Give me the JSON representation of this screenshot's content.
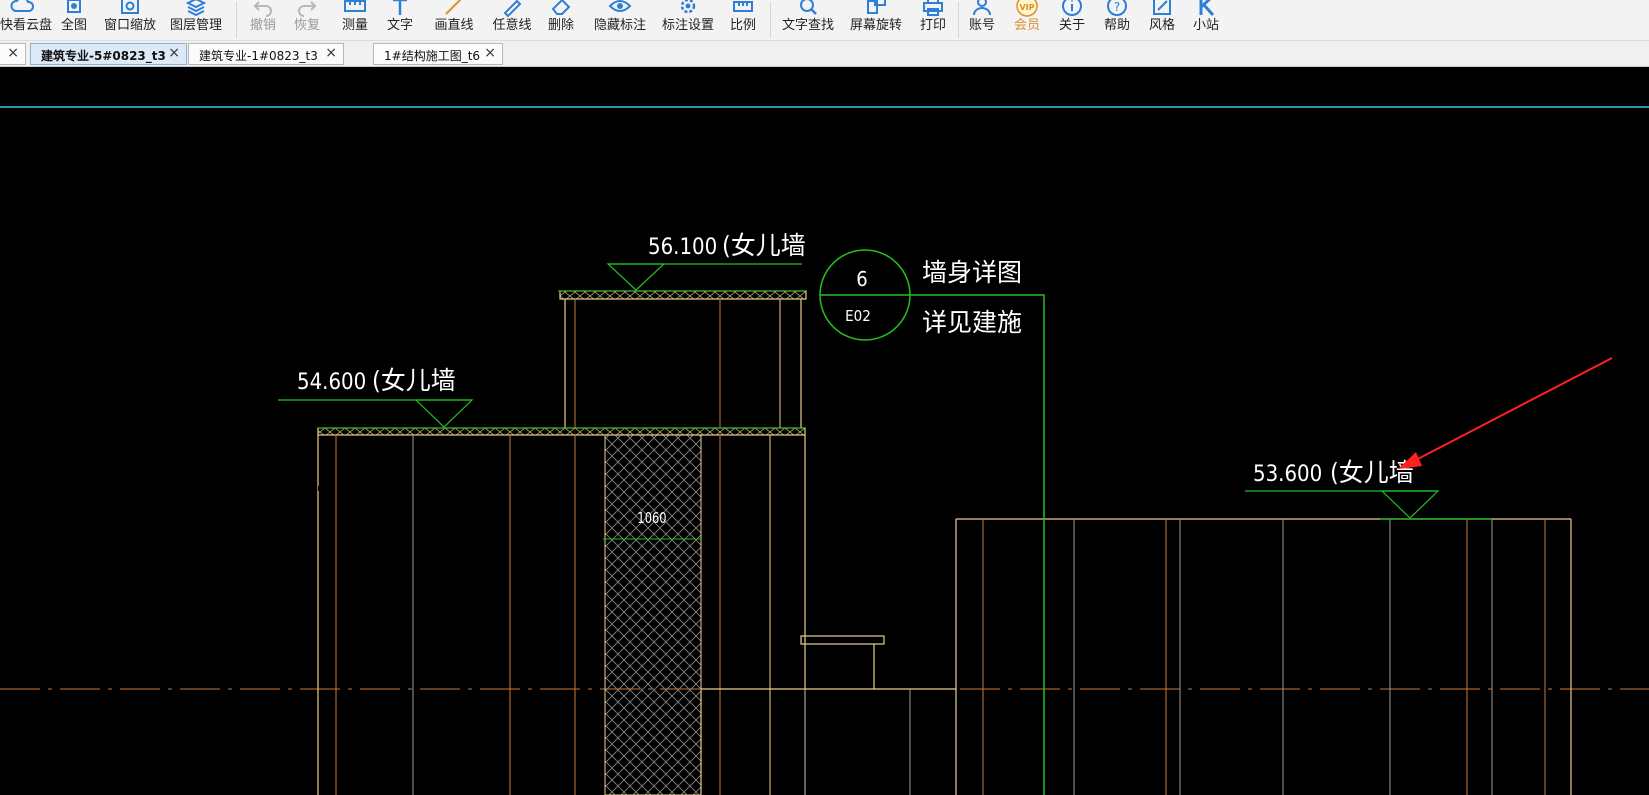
{
  "toolbar": {
    "items": [
      {
        "label": "快看云盘",
        "icon": "cloud-icon"
      },
      {
        "label": "全图",
        "icon": "fullview-icon"
      },
      {
        "label": "窗口缩放",
        "icon": "zoom-window-icon"
      },
      {
        "label": "图层管理",
        "icon": "layers-icon"
      },
      {
        "label": "撤销",
        "icon": "undo-icon"
      },
      {
        "label": "恢复",
        "icon": "redo-icon"
      },
      {
        "label": "测量",
        "icon": "ruler-icon"
      },
      {
        "label": "文字",
        "icon": "text-icon"
      },
      {
        "label": "画直线",
        "icon": "line-icon"
      },
      {
        "label": "任意线",
        "icon": "freehand-icon"
      },
      {
        "label": "删除",
        "icon": "eraser-icon"
      },
      {
        "label": "隐藏标注",
        "icon": "eye-icon"
      },
      {
        "label": "标注设置",
        "icon": "gear-icon"
      },
      {
        "label": "比例",
        "icon": "scale-icon"
      },
      {
        "label": "文字查找",
        "icon": "search-text-icon"
      },
      {
        "label": "屏幕旋转",
        "icon": "rotate-icon"
      },
      {
        "label": "打印",
        "icon": "printer-icon"
      },
      {
        "label": "账号",
        "icon": "user-icon"
      },
      {
        "label": "会员",
        "icon": "vip-icon"
      },
      {
        "label": "关于",
        "icon": "info-icon"
      },
      {
        "label": "帮助",
        "icon": "help-icon"
      },
      {
        "label": "风格",
        "icon": "style-icon"
      },
      {
        "label": "小站",
        "icon": "station-icon"
      }
    ],
    "vip_badge": "VIP"
  },
  "tabs": [
    {
      "label": "",
      "close": "×"
    },
    {
      "label": "建筑专业-5#0823_t3",
      "close": "×",
      "active": true
    },
    {
      "label": "建筑专业-1#0823_t3",
      "close": "×"
    },
    {
      "label": "1#结构施工图_t6",
      "close": "×"
    }
  ],
  "drawing": {
    "elev_top": "56.100",
    "elev_top_note": "(女儿墙",
    "elev_left": "54.600",
    "elev_left_note": "(女儿墙",
    "elev_right": "53.600",
    "elev_right_note": "(女儿墙",
    "detail_number": "6",
    "detail_sheet": "E02",
    "detail_note_1": "墙身详图",
    "detail_note_2": "详见建施",
    "dimension": "1060"
  },
  "colors": {
    "toolbar_bg": "#f3f3f3",
    "icon_blue": "#2f7fd6",
    "active_tab": "#dce9f7",
    "canvas_bg": "#000000",
    "cad_yellow": "#e8cf8a",
    "cad_orange": "#c97a3c",
    "cad_green": "#22c022",
    "cad_cyan": "#3fc6d8",
    "cad_grey": "#9a9a9a",
    "arrow_red": "#ff2020"
  }
}
